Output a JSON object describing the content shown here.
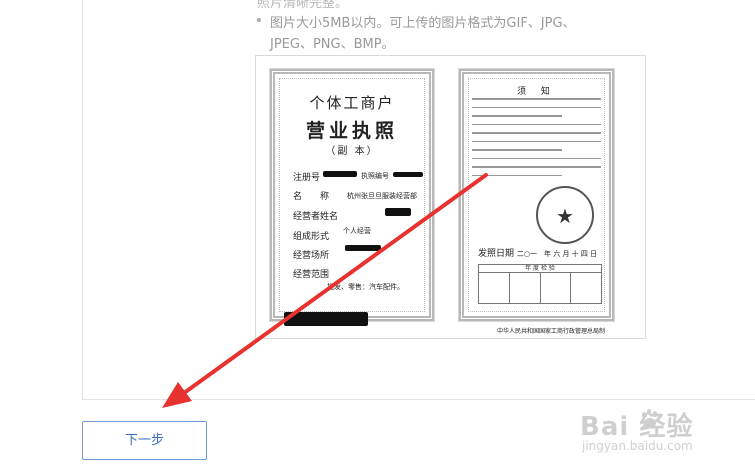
{
  "requirements": {
    "cut_line": "照片清晰完整。",
    "size_format_line1": "图片大小5MB以内。可上传的图片格式为GIF、JPG、",
    "size_format_line2": "JPEG、PNG、BMP。"
  },
  "sample_license": {
    "title_line1": "个体工商户",
    "title_line2": "营业执照",
    "title_line3": "（副 本）",
    "reg_no_label": "注册号",
    "license_no_label": "执照编号",
    "name_label": "名　　称",
    "name_value": "杭州张旦旦服装经营部",
    "operator_label": "经营者姓名",
    "form_label": "组成形式",
    "form_value": "个人经营",
    "place_label": "经营场所",
    "scope_label": "经营范围",
    "scope_value": "批发、零售：汽车配件。",
    "notice_title": "须 知",
    "issue_date_label": "发照日期",
    "issue_date_value": "二○一　年 六 月 十 四 日",
    "annual_label": "年 度 检 验",
    "authority": "中华人民共和国国家工商行政管理总局制"
  },
  "actions": {
    "next_label": "下一步"
  },
  "watermark": {
    "logo": "Bai  经验",
    "url": "jingyan.baidu.com"
  },
  "colors": {
    "button_border": "#6f9bd7",
    "button_text": "#3b6fc0",
    "arrow": "#e8322f"
  }
}
